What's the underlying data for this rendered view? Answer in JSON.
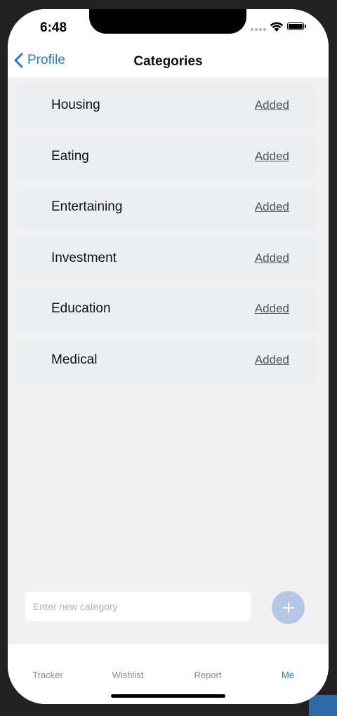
{
  "status_bar": {
    "time": "6:48"
  },
  "nav": {
    "back_label": "Profile",
    "title": "Categories"
  },
  "categories": [
    {
      "name": "Housing",
      "status": "Added"
    },
    {
      "name": "Eating",
      "status": "Added"
    },
    {
      "name": "Entertaining",
      "status": "Added"
    },
    {
      "name": "Investment",
      "status": "Added"
    },
    {
      "name": "Education",
      "status": "Added"
    },
    {
      "name": "Medical",
      "status": "Added"
    }
  ],
  "new_category": {
    "value": "",
    "placeholder": "Enter new category"
  },
  "add_button": {
    "icon": "plus-icon"
  },
  "tabs": [
    {
      "label": "Tracker",
      "active": false
    },
    {
      "label": "Wishlist",
      "active": false
    },
    {
      "label": "Report",
      "active": false
    },
    {
      "label": "Me",
      "active": true
    }
  ],
  "colors": {
    "accent": "#1f7ae0",
    "row_background": "#ebeff2",
    "add_button": "#b4c7e4"
  }
}
